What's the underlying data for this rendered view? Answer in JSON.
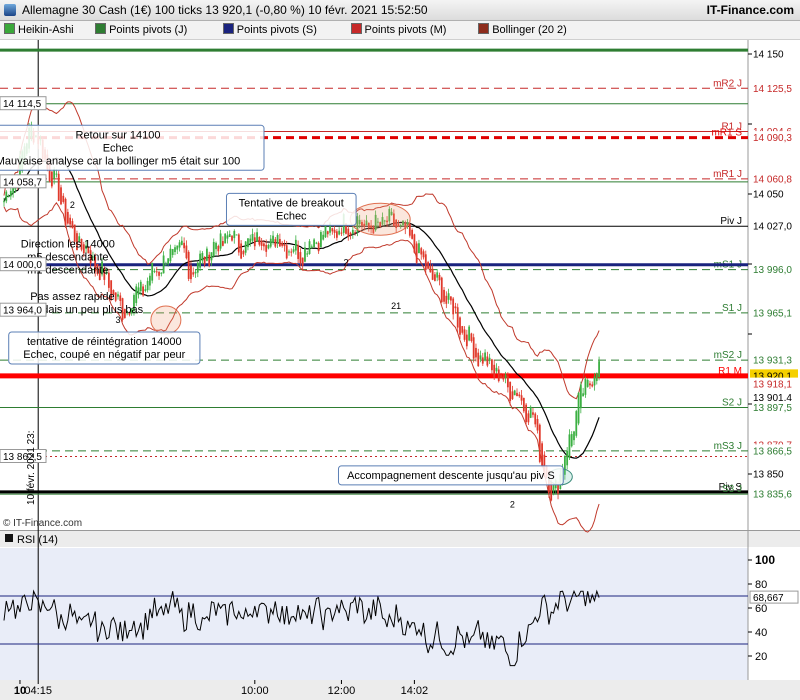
{
  "window": {
    "title": "Allemagne 30 Cash (1€) 100 ticks 13 920,1 (-0,80 %) 10 févr. 2021 15:52:50",
    "brand": "IT-Finance.com",
    "watermark": "© IT-Finance.com"
  },
  "legend": [
    {
      "label": "Heikin-Ashi",
      "color": "#3aa83a"
    },
    {
      "label": "Points pivots (J)",
      "color": "#2e7d32"
    },
    {
      "label": "Points pivots (S)",
      "color": "#1a237e"
    },
    {
      "label": "Points pivots (M)",
      "color": "#c62828"
    },
    {
      "label": "Bollinger (20 2)",
      "color": "#8d2c1c"
    }
  ],
  "colors": {
    "up": "#3cb043",
    "down": "#e0392b",
    "boll": "#c0392b",
    "ma": "#000000",
    "pivotJ": "#2e7d32",
    "pivotS": "#1a237e",
    "pivotM": "#e00000",
    "rsi": "#000000"
  },
  "chart_data": {
    "type": "candlestick",
    "instrument": "Allemagne 30 Cash (1€)",
    "interval": "100 ticks",
    "last": 13920.1,
    "ylim": [
      13810,
      14160
    ],
    "price_ticks": [
      14150,
      14100,
      14050,
      14000,
      13950,
      13900,
      13850
    ],
    "price_tick_labels": [
      "14 150",
      "14 100",
      "14 050",
      "14 000",
      "13 950",
      "13 900",
      "13 850"
    ],
    "time_labels": [
      {
        "label": "10",
        "bar": 7,
        "bold": true
      },
      {
        "label": "04:15",
        "bar": 15
      },
      {
        "label": "10:00",
        "bar": 110
      },
      {
        "label": "12:00",
        "bar": 148
      },
      {
        "label": "14:02",
        "bar": 180
      }
    ],
    "vertical_date_label": "10 févr. 2021 23:",
    "close_path": [
      [
        0,
        14045
      ],
      [
        6,
        14065
      ],
      [
        12,
        14100
      ],
      [
        18,
        14075
      ],
      [
        24,
        14050
      ],
      [
        30,
        14020
      ],
      [
        36,
        14010
      ],
      [
        40,
        14000
      ],
      [
        46,
        13985
      ],
      [
        52,
        13965
      ],
      [
        56,
        13975
      ],
      [
        62,
        13985
      ],
      [
        66,
        13995
      ],
      [
        72,
        14005
      ],
      [
        78,
        14010
      ],
      [
        82,
        13995
      ],
      [
        88,
        14005
      ],
      [
        94,
        14015
      ],
      [
        100,
        14020
      ],
      [
        106,
        14010
      ],
      [
        110,
        14020
      ],
      [
        116,
        14015
      ],
      [
        120,
        14018
      ],
      [
        126,
        14012
      ],
      [
        130,
        14008
      ],
      [
        134,
        14015
      ],
      [
        138,
        14020
      ],
      [
        144,
        14022
      ],
      [
        150,
        14028
      ],
      [
        156,
        14030
      ],
      [
        162,
        14025
      ],
      [
        166,
        14030
      ],
      [
        172,
        14028
      ],
      [
        178,
        14018
      ],
      [
        184,
        14000
      ],
      [
        190,
        13985
      ],
      [
        196,
        13970
      ],
      [
        202,
        13950
      ],
      [
        208,
        13935
      ],
      [
        214,
        13925
      ],
      [
        220,
        13915
      ],
      [
        226,
        13905
      ],
      [
        232,
        13890
      ],
      [
        236,
        13860
      ],
      [
        240,
        13835
      ],
      [
        244,
        13850
      ],
      [
        248,
        13875
      ],
      [
        252,
        13900
      ],
      [
        256,
        13915
      ],
      [
        260,
        13925
      ]
    ],
    "pivots": [
      {
        "label": "",
        "value": 14152.8,
        "color": "#2e7d32",
        "style": "solid",
        "width": 3
      },
      {
        "label": "mR2 J",
        "value": 14125.5,
        "color": "#c62828",
        "style": "dash",
        "width": 1
      },
      {
        "label": "",
        "value": 14114.5,
        "color": "#2e7d32",
        "style": "solid",
        "width": 1
      },
      {
        "label": "R1 J",
        "value": 14094.6,
        "color": "#c62828",
        "style": "solid",
        "width": 1
      },
      {
        "label": "mR1 S",
        "value": 14090.3,
        "color": "#e00000",
        "style": "dash",
        "width": 3
      },
      {
        "label": "mR1 J",
        "value": 14060.8,
        "color": "#c62828",
        "style": "dash",
        "width": 1
      },
      {
        "label": "",
        "value": 14058.7,
        "color": "#2e7d32",
        "style": "solid",
        "width": 1
      },
      {
        "label": "Piv J",
        "value": 14027.0,
        "color": "#000000",
        "style": "solid",
        "width": 1
      },
      {
        "label": "mS1 J",
        "value": 13996.0,
        "color": "#2e7d32",
        "style": "dash",
        "width": 1
      },
      {
        "label": "",
        "value": 13999.5,
        "color": "#1a237e",
        "style": "solid",
        "width": 3
      },
      {
        "label": "S1 J",
        "value": 13965.1,
        "color": "#2e7d32",
        "style": "dash",
        "width": 1
      },
      {
        "label": "mS2 J",
        "value": 13931.3,
        "color": "#2e7d32",
        "style": "dash",
        "width": 1
      },
      {
        "label": "R1 M",
        "value": 13920.1,
        "color": "#ff0000",
        "style": "solid",
        "width": 5
      },
      {
        "label": "S2 J",
        "value": 13897.5,
        "color": "#2e7d32",
        "style": "solid",
        "width": 1
      },
      {
        "label": "mS3 J",
        "value": 13866.5,
        "color": "#2e7d32",
        "style": "dash",
        "width": 1
      },
      {
        "label": "",
        "value": 13862.5,
        "color": "#c62828",
        "style": "dot",
        "width": 1
      },
      {
        "label": "Piv S",
        "value": 13837.2,
        "color": "#000000",
        "style": "solid",
        "width": 3
      },
      {
        "label": "S3 J",
        "value": 13835.6,
        "color": "#2e7d32",
        "style": "solid",
        "width": 1
      }
    ],
    "price_tags": [
      {
        "text": "14 150",
        "value": 14150,
        "bg": "#ffffff",
        "fg": "#000000"
      },
      {
        "text": "14 125,5",
        "value": 14125.5,
        "bg": "#ffffff",
        "fg": "#c62828"
      },
      {
        "text": "14 094,6",
        "value": 14094.6,
        "bg": "#ffffff",
        "fg": "#c62828"
      },
      {
        "text": "14 090,3",
        "value": 14090.3,
        "bg": "#ffffff",
        "fg": "#c62828"
      },
      {
        "text": "14 060,8",
        "value": 14060.8,
        "bg": "#ffffff",
        "fg": "#c62828"
      },
      {
        "text": "14 050",
        "value": 14050,
        "bg": "#ffffff",
        "fg": "#000000"
      },
      {
        "text": "14 027,0",
        "value": 14027.0,
        "bg": "#ffffff",
        "fg": "#000000"
      },
      {
        "text": "13 996,0",
        "value": 13996.0,
        "bg": "#ffffff",
        "fg": "#2e7d32"
      },
      {
        "text": "13 965,1",
        "value": 13965.1,
        "bg": "#ffffff",
        "fg": "#2e7d32"
      },
      {
        "text": "13 931,3",
        "value": 13931.3,
        "bg": "#ffffff",
        "fg": "#2e7d32"
      },
      {
        "text": "13 920,1",
        "value": 13920.1,
        "bg": "#f5d000",
        "fg": "#000000"
      },
      {
        "text": "13 918,1",
        "value": 13914.2,
        "bg": "#ffffff",
        "fg": "#c62828"
      },
      {
        "text": "13 901,4",
        "value": 13904.5,
        "bg": "#ffffff",
        "fg": "#000000"
      },
      {
        "text": "13 897,5",
        "value": 13897.5,
        "bg": "#ffffff",
        "fg": "#2e7d32"
      },
      {
        "text": "13 870,7",
        "value": 13870.7,
        "bg": "#ffffff",
        "fg": "#c62828"
      },
      {
        "text": "13 866,5",
        "value": 13866.5,
        "bg": "#ffffff",
        "fg": "#2e7d32"
      },
      {
        "text": "13 850",
        "value": 13850,
        "bg": "#ffffff",
        "fg": "#000000"
      },
      {
        "text": "13 837,2",
        "value": 13837.2,
        "bg": "#ffffff",
        "fg": "#000000"
      },
      {
        "text": "13 835,6",
        "value": 13835.6,
        "bg": "#ffffff",
        "fg": "#2e7d32"
      }
    ],
    "left_tags": [
      {
        "text": "14 114,5",
        "value": 14114.5
      },
      {
        "text": "14 058,7",
        "value": 14058.7
      },
      {
        "text": "14 000,0",
        "value": 13999.5
      },
      {
        "text": "13 964,0",
        "value": 13967.0
      },
      {
        "text": "13 862,5",
        "value": 13862.5
      }
    ],
    "annotations": [
      {
        "lines": [
          "Retour sur 14100",
          "Echec",
          "Mauvaise analyse car la bollinger m5 était sur 100"
        ],
        "bar": 50,
        "value": 14083,
        "boxed": true
      },
      {
        "lines": [
          "Tentative de breakout",
          "Echec"
        ],
        "bar": 126,
        "value": 14039,
        "boxed": true
      },
      {
        "lines": [
          "Direction les 14000",
          "m5 descendante",
          "m1 descendante"
        ],
        "bar": 28,
        "value": 14005,
        "boxed": false
      },
      {
        "lines": [
          "Pas assez rapide",
          "je l'attendais un peu plus bas"
        ],
        "bar": 30,
        "value": 13972,
        "boxed": false
      },
      {
        "lines": [
          "tentative de réintégration 14000",
          "Echec, coupé en négatif par peur"
        ],
        "bar": 44,
        "value": 13940,
        "boxed": true
      },
      {
        "lines": [
          "Accompagnement descente jusqu'au piv S"
        ],
        "bar": 196,
        "value": 13849,
        "boxed": true
      }
    ],
    "markers": [
      {
        "label": "2",
        "bar": 30,
        "value": 14040
      },
      {
        "label": "3",
        "bar": 50,
        "value": 13958
      },
      {
        "label": "2",
        "bar": 150,
        "value": 13999
      },
      {
        "label": "21",
        "bar": 172,
        "value": 13968
      },
      {
        "label": "2",
        "bar": 223,
        "value": 13826
      }
    ],
    "rsi": {
      "label": "RSI (14)",
      "value": 68.667,
      "value_label": "68,667",
      "ylim": [
        0,
        110
      ],
      "ticks": [
        100,
        80,
        60,
        40,
        20
      ],
      "levels": [
        70,
        30
      ],
      "path": [
        [
          0,
          60
        ],
        [
          8,
          62
        ],
        [
          16,
          64
        ],
        [
          24,
          55
        ],
        [
          32,
          48
        ],
        [
          40,
          45
        ],
        [
          48,
          42
        ],
        [
          56,
          44
        ],
        [
          64,
          52
        ],
        [
          72,
          60
        ],
        [
          80,
          55
        ],
        [
          88,
          50
        ],
        [
          96,
          58
        ],
        [
          104,
          54
        ],
        [
          112,
          60
        ],
        [
          120,
          58
        ],
        [
          128,
          55
        ],
        [
          136,
          54
        ],
        [
          144,
          56
        ],
        [
          152,
          60
        ],
        [
          160,
          58
        ],
        [
          168,
          52
        ],
        [
          176,
          48
        ],
        [
          184,
          40
        ],
        [
          192,
          32
        ],
        [
          200,
          33
        ],
        [
          208,
          35
        ],
        [
          216,
          30
        ],
        [
          224,
          20
        ],
        [
          228,
          35
        ],
        [
          232,
          52
        ],
        [
          240,
          62
        ],
        [
          248,
          67
        ],
        [
          256,
          70
        ],
        [
          260,
          68.7
        ]
      ]
    }
  }
}
